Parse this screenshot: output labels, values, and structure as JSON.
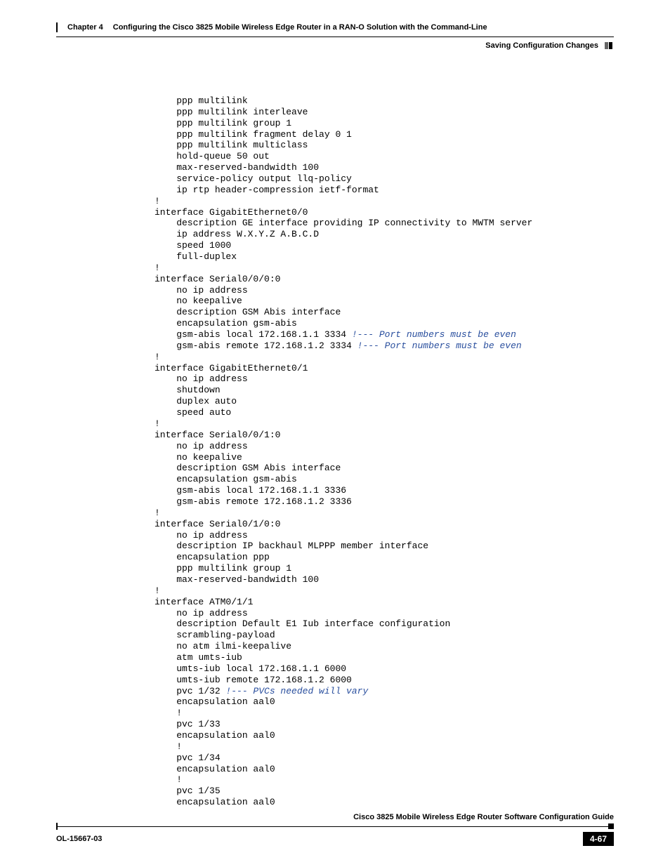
{
  "header": {
    "chapter_label": "Chapter 4",
    "chapter_title": "Configuring the Cisco 3825 Mobile Wireless Edge Router in a RAN-O Solution with the Command-Line",
    "section_title": "Saving Configuration Changes"
  },
  "code": {
    "lines": [
      {
        "indent": 1,
        "text": "ppp multilink"
      },
      {
        "indent": 1,
        "text": "ppp multilink interleave"
      },
      {
        "indent": 1,
        "text": "ppp multilink group 1"
      },
      {
        "indent": 1,
        "text": "ppp multilink fragment delay 0 1"
      },
      {
        "indent": 1,
        "text": "ppp multilink multiclass"
      },
      {
        "indent": 1,
        "text": "hold-queue 50 out"
      },
      {
        "indent": 1,
        "text": "max-reserved-bandwidth 100"
      },
      {
        "indent": 1,
        "text": "service-policy output llq-policy"
      },
      {
        "indent": 1,
        "text": "ip rtp header-compression ietf-format"
      },
      {
        "indent": 0,
        "text": "!"
      },
      {
        "indent": 0,
        "text": "interface GigabitEthernet0/0"
      },
      {
        "indent": 1,
        "text": "description GE interface providing IP connectivity to MWTM server"
      },
      {
        "indent": 1,
        "text": "ip address W.X.Y.Z A.B.C.D"
      },
      {
        "indent": 1,
        "text": "speed 1000"
      },
      {
        "indent": 1,
        "text": "full-duplex"
      },
      {
        "indent": 0,
        "text": "!"
      },
      {
        "indent": 0,
        "text": "interface Serial0/0/0:0"
      },
      {
        "indent": 1,
        "text": "no ip address"
      },
      {
        "indent": 1,
        "text": "no keepalive"
      },
      {
        "indent": 1,
        "text": "description GSM Abis interface"
      },
      {
        "indent": 1,
        "text": "encapsulation gsm-abis"
      },
      {
        "indent": 1,
        "text": "gsm-abis local 172.168.1.1 3334 ",
        "comment": "!--- Port numbers must be even"
      },
      {
        "indent": 1,
        "text": "gsm-abis remote 172.168.1.2 3334 ",
        "comment": "!--- Port numbers must be even"
      },
      {
        "indent": 0,
        "text": "!"
      },
      {
        "indent": 0,
        "text": "interface GigabitEthernet0/1"
      },
      {
        "indent": 1,
        "text": "no ip address"
      },
      {
        "indent": 1,
        "text": "shutdown"
      },
      {
        "indent": 1,
        "text": "duplex auto"
      },
      {
        "indent": 1,
        "text": "speed auto"
      },
      {
        "indent": 0,
        "text": "!"
      },
      {
        "indent": 0,
        "text": "interface Serial0/0/1:0"
      },
      {
        "indent": 1,
        "text": "no ip address"
      },
      {
        "indent": 1,
        "text": "no keepalive"
      },
      {
        "indent": 1,
        "text": "description GSM Abis interface"
      },
      {
        "indent": 1,
        "text": "encapsulation gsm-abis"
      },
      {
        "indent": 1,
        "text": "gsm-abis local 172.168.1.1 3336"
      },
      {
        "indent": 1,
        "text": "gsm-abis remote 172.168.1.2 3336"
      },
      {
        "indent": 0,
        "text": "!"
      },
      {
        "indent": 0,
        "text": "interface Serial0/1/0:0"
      },
      {
        "indent": 1,
        "text": "no ip address"
      },
      {
        "indent": 1,
        "text": "description IP backhaul MLPPP member interface"
      },
      {
        "indent": 1,
        "text": "encapsulation ppp"
      },
      {
        "indent": 1,
        "text": "ppp multilink group 1"
      },
      {
        "indent": 1,
        "text": "max-reserved-bandwidth 100"
      },
      {
        "indent": 0,
        "text": "!"
      },
      {
        "indent": 0,
        "text": "interface ATM0/1/1"
      },
      {
        "indent": 1,
        "text": "no ip address"
      },
      {
        "indent": 1,
        "text": "description Default E1 Iub interface configuration"
      },
      {
        "indent": 1,
        "text": "scrambling-payload"
      },
      {
        "indent": 1,
        "text": "no atm ilmi-keepalive"
      },
      {
        "indent": 1,
        "text": "atm umts-iub"
      },
      {
        "indent": 1,
        "text": "umts-iub local 172.168.1.1 6000"
      },
      {
        "indent": 1,
        "text": "umts-iub remote 172.168.1.2 6000"
      },
      {
        "indent": 1,
        "text": "pvc 1/32 ",
        "comment": "!--- PVCs needed will vary"
      },
      {
        "indent": 1,
        "text": "encapsulation aal0"
      },
      {
        "indent": 1,
        "text": "!"
      },
      {
        "indent": 1,
        "text": "pvc 1/33"
      },
      {
        "indent": 1,
        "text": "encapsulation aal0"
      },
      {
        "indent": 1,
        "text": "!"
      },
      {
        "indent": 1,
        "text": "pvc 1/34"
      },
      {
        "indent": 1,
        "text": "encapsulation aal0"
      },
      {
        "indent": 1,
        "text": "!"
      },
      {
        "indent": 1,
        "text": "pvc 1/35"
      },
      {
        "indent": 1,
        "text": "encapsulation aal0"
      }
    ]
  },
  "footer": {
    "guide_title": "Cisco 3825 Mobile Wireless Edge Router Software Configuration Guide",
    "doc_id": "OL-15667-03",
    "page_number": "4-67"
  }
}
